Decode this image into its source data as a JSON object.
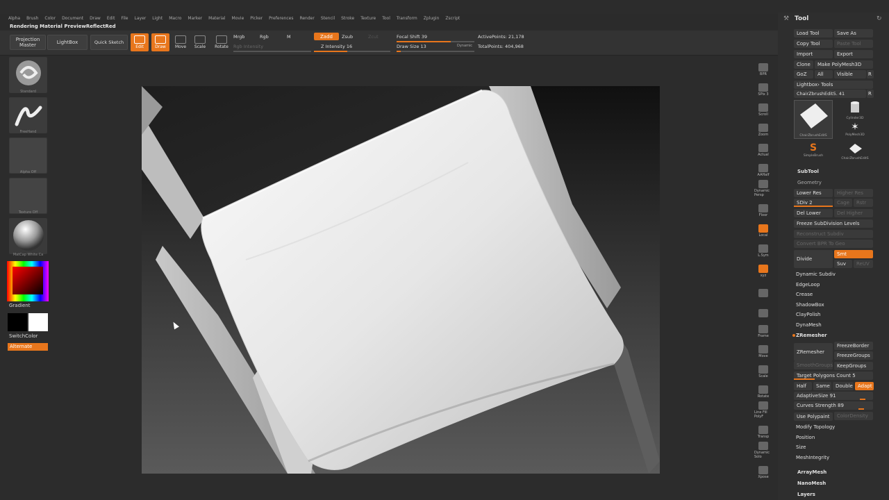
{
  "menu": [
    "Alpha",
    "Brush",
    "Color",
    "Document",
    "Draw",
    "Edit",
    "File",
    "Layer",
    "Light",
    "Macro",
    "Marker",
    "Material",
    "Movie",
    "Picker",
    "Preferences",
    "Render",
    "Stencil",
    "Stroke",
    "Texture",
    "Tool",
    "Transform",
    "Zplugin",
    "Zscript"
  ],
  "title": "Rendering Material PreviewReflectRed",
  "toolbar": {
    "projection_master": "Projection Master",
    "lightbox": "LightBox",
    "quick_sketch": "Quick Sketch",
    "edit": "Edit",
    "draw": "Draw",
    "move": "Move",
    "scale": "Scale",
    "rotate": "Rotate",
    "mrgb": "Mrgb",
    "rgb": "Rgb",
    "m": "M",
    "rgb_intensity": "Rgb Intensity",
    "zadd": "Zadd",
    "zsub": "Zsub",
    "zcut": "Zcut",
    "z_intensity_label": "Z Intensity",
    "z_intensity": "16",
    "focal_shift_label": "Focal Shift",
    "focal_shift": "39",
    "draw_size_label": "Draw Size",
    "draw_size": "13",
    "dynamic": "Dynamic",
    "active_points_label": "ActivePoints:",
    "active_points": "21,178",
    "total_points_label": "TotalPoints:",
    "total_points": "404,968"
  },
  "left": {
    "brush": "Standard",
    "stroke": "FreeHand",
    "alpha": "Alpha Off",
    "texture": "Texture Off",
    "material": "MatCap White Ca",
    "gradient": "Gradient",
    "switchcolor": "SwitchColor",
    "alternate": "Alternate"
  },
  "right_shelf": [
    "BPR",
    "SPix 3",
    "Scroll",
    "Zoom",
    "Actual",
    "AAHalf",
    "Dynamic Persp",
    "Floor",
    "Local",
    "L.Sym",
    "xyz",
    "",
    "",
    "Frame",
    "Move",
    "Scale",
    "Rotate",
    "Line Fill PolyF",
    "Transp",
    "Dynamic Solo",
    "Xpose"
  ],
  "panel": {
    "title": "Tool",
    "load_tool": "Load Tool",
    "save_as": "Save As",
    "copy_tool": "Copy Tool",
    "paste_tool": "Paste Tool",
    "import": "Import",
    "export": "Export",
    "clone": "Clone",
    "make_polymesh": "Make PolyMesh3D",
    "goz": "GoZ",
    "all": "All",
    "visible": "Visible",
    "r": "R",
    "lightbox_tools": "Lightbox› Tools",
    "current_tool": "ChairZbrushEdit5. 41",
    "tools": [
      {
        "name": "ChairZbrushEditS"
      },
      {
        "name": "Cylinder3D"
      },
      {
        "name": "PolyMesh3D"
      },
      {
        "name": "SimpleBrush"
      },
      {
        "name": "ChairZbrushEditS"
      }
    ],
    "subtool": "SubTool",
    "geometry": "Geometry",
    "lower_res": "Lower Res",
    "higher_res": "Higher Res",
    "sdiv": "SDiv 2",
    "cage": "Cage",
    "rstr": "Rstr",
    "del_lower": "Del Lower",
    "del_higher": "Del Higher",
    "freeze_subdiv": "Freeze SubDivision Levels",
    "reconstruct_subdiv": "Reconstruct Subdiv",
    "convert_bpr": "Convert BPR To Geo",
    "divide": "Divide",
    "smt": "Smt",
    "suv": "Suv",
    "reuv": "ReUV",
    "dynamic_subdiv": "Dynamic Subdiv",
    "edgeloop": "EdgeLoop",
    "crease": "Crease",
    "shadowbox": "ShadowBox",
    "claypolish": "ClayPolish",
    "dynamesh": "DynaMesh",
    "zremesher_header": "ZRemesher",
    "zremesher": "ZRemesher",
    "freeze_border": "FreezeBorder",
    "freeze_groups": "FreezeGroups",
    "smooth_groups": "SmoothGroups",
    "keep_groups": "KeepGroups",
    "target_polygons_label": "Target Polygons Count",
    "target_polygons": "5",
    "half": "Half",
    "same": "Same",
    "double": "Double",
    "adapt": "Adapt",
    "adaptive_size_label": "AdaptiveSize",
    "adaptive_size": "91",
    "curves_strength_label": "Curves Strength",
    "curves_strength": "89",
    "use_polypaint": "Use Polypaint",
    "color_density": "ColorDensity",
    "modify_topology": "Modify Topology",
    "position": "Position",
    "size": "Size",
    "mesh_integrity": "MeshIntegrity",
    "array_mesh": "ArrayMesh",
    "nano_mesh": "NanoMesh",
    "layers": "Layers"
  },
  "colors": {
    "accent": "#e8761c",
    "bg": "#2c2c2c"
  }
}
